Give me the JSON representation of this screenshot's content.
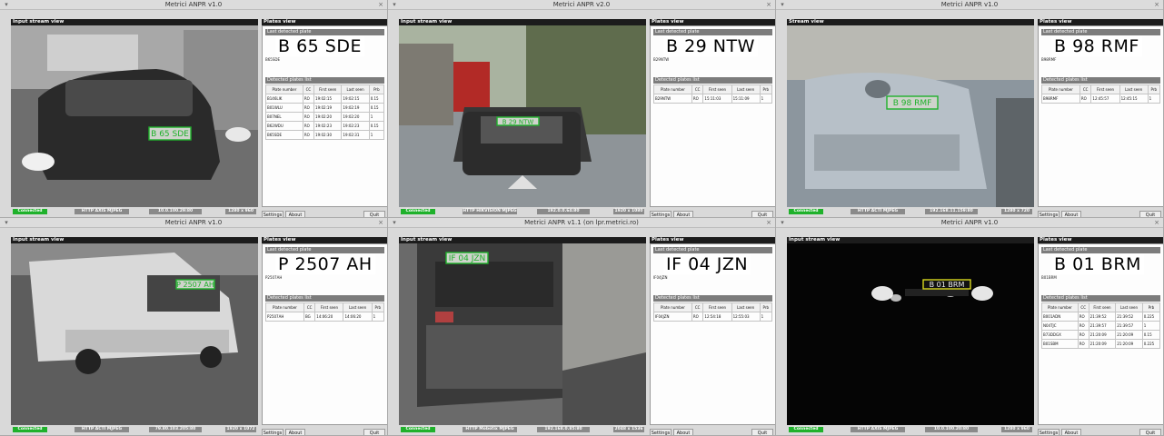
{
  "windows": [
    {
      "title": "Metrici ANPR v1.0",
      "stream_label": "Input stream view",
      "plates_label": "Plates view",
      "last_detected_label": "Last detected plate",
      "last_plate": "B 65 SDE",
      "last_plate_small": "B65SDE",
      "detected_list_label": "Detected plates list",
      "columns": [
        "Plate number",
        "CC",
        "First seen",
        "Last seen",
        "Prb"
      ],
      "rows": [
        [
          "B146LIK",
          "RO",
          "19:02:15",
          "19:02:15",
          "0.15"
        ],
        [
          "B01WLU",
          "RO",
          "19:02:19",
          "19:02:19",
          "0.15"
        ],
        [
          "B07NEL",
          "RO",
          "19:02:20",
          "19:02:20",
          "1"
        ],
        [
          "B62WDU",
          "RO",
          "19:02:23",
          "19:02:23",
          "0.15"
        ],
        [
          "B65SDE",
          "RO",
          "19:02:30",
          "19:02:31",
          "1"
        ]
      ],
      "status": [
        "Connected",
        "HTTP AXIS MJPEG",
        "10.0.100.29:80",
        "1280 x 960"
      ],
      "buttons": {
        "settings": "Settings",
        "about": "About",
        "quit": "Quit"
      }
    },
    {
      "title": "Metrici ANPR v2.0",
      "stream_label": "Input stream view",
      "plates_label": "Plates view",
      "last_detected_label": "Last detected plate",
      "last_plate": "B 29 NTW",
      "last_plate_small": "B29NTW",
      "detected_list_label": "Detected plates list",
      "columns": [
        "Plate number",
        "CC",
        "First seen",
        "Last seen",
        "Prb"
      ],
      "rows": [
        [
          "B29NTW",
          "RO",
          "15:11:03",
          "15:11:09",
          "1"
        ]
      ],
      "status": [
        "Connected",
        "HTTP HIKVISION MJPEG",
        "192.0.0.64:80",
        "1920 x 1080"
      ],
      "buttons": {
        "settings": "Settings",
        "about": "About",
        "quit": "Quit"
      }
    },
    {
      "title": "Metrici ANPR v1.0",
      "stream_label": "Stream view",
      "plates_label": "Plates view",
      "last_detected_label": "Last detected plate",
      "last_plate": "B 98 RMF",
      "last_plate_small": "B98RMF",
      "detected_list_label": "Detected plates list",
      "columns": [
        "Plate number",
        "CC",
        "First seen",
        "Last seen",
        "Prb"
      ],
      "rows": [
        [
          "B98RMF",
          "RO",
          "12:45:57",
          "12:45:15",
          "1"
        ]
      ],
      "status": [
        "Connected",
        "HTTP ACTI MJPEG",
        "192.168.11.159:80",
        "1280 x 720"
      ],
      "buttons": {
        "settings": "Settings",
        "about": "About",
        "quit": "Quit"
      }
    },
    {
      "title": "Metrici ANPR v1.0",
      "stream_label": "Input stream view",
      "plates_label": "Plates view",
      "last_detected_label": "Last detected plate",
      "last_plate": "P 2507 AH",
      "last_plate_small": "P2507AH",
      "detected_list_label": "Detected plates list",
      "columns": [
        "Plate number",
        "CC",
        "First seen",
        "Last seen",
        "Prb"
      ],
      "rows": [
        [
          "P2507AH",
          "BG",
          "14:06:20",
          "14:06:20",
          "1"
        ]
      ],
      "status": [
        "Connected",
        "HTTP ACTI MJPEG",
        "79.80.103.205:80",
        "1920 x 1072"
      ],
      "buttons": {
        "settings": "Settings",
        "about": "About",
        "quit": "Quit"
      }
    },
    {
      "title": "Metrici ANPR v1.1 (on lpr.metrici.ro)",
      "stream_label": "Input stream view",
      "plates_label": "Plates view",
      "last_detected_label": "Last detected plate",
      "last_plate": "IF 04 JZN",
      "last_plate_small": "IF04JZN",
      "detected_list_label": "Detected plates list",
      "columns": [
        "Plate number",
        "CC",
        "First seen",
        "Last seen",
        "Prb"
      ],
      "rows": [
        [
          "IF04JZN",
          "RO",
          "12:54:18",
          "12:55:03",
          "1"
        ]
      ],
      "status": [
        "Connected",
        "HTTP Mobotix MJPEG",
        "192.168.0.85:80",
        "2048 x 1536"
      ],
      "buttons": {
        "settings": "Settings",
        "about": "About",
        "quit": "Quit"
      }
    },
    {
      "title": "Metrici ANPR v1.0",
      "stream_label": "Input stream view",
      "plates_label": "Plates view",
      "last_detected_label": "Last detected plate",
      "last_plate": "B 01 BRM",
      "last_plate_small": "B01BRM",
      "detected_list_label": "Detected plates list",
      "columns": [
        "Plate number",
        "CC",
        "First seen",
        "Last seen",
        "Prb"
      ],
      "rows": [
        [
          "B001ADN",
          "RO",
          "21:39:52",
          "21:39:52",
          "0.225"
        ],
        [
          "N04TJC",
          "RO",
          "21:39:57",
          "21:39:57",
          "1"
        ],
        [
          "B73DDGX",
          "RO",
          "21:20:09",
          "21:20:09",
          "0.15"
        ],
        [
          "B01SBM",
          "RO",
          "21:20:09",
          "21:20:09",
          "0.225"
        ]
      ],
      "status": [
        "Connected",
        "HTTP AXIS MJPEG",
        "10.0.100.20:80",
        "1280 x 960"
      ],
      "buttons": {
        "settings": "Settings",
        "about": "About",
        "quit": "Quit"
      }
    }
  ]
}
